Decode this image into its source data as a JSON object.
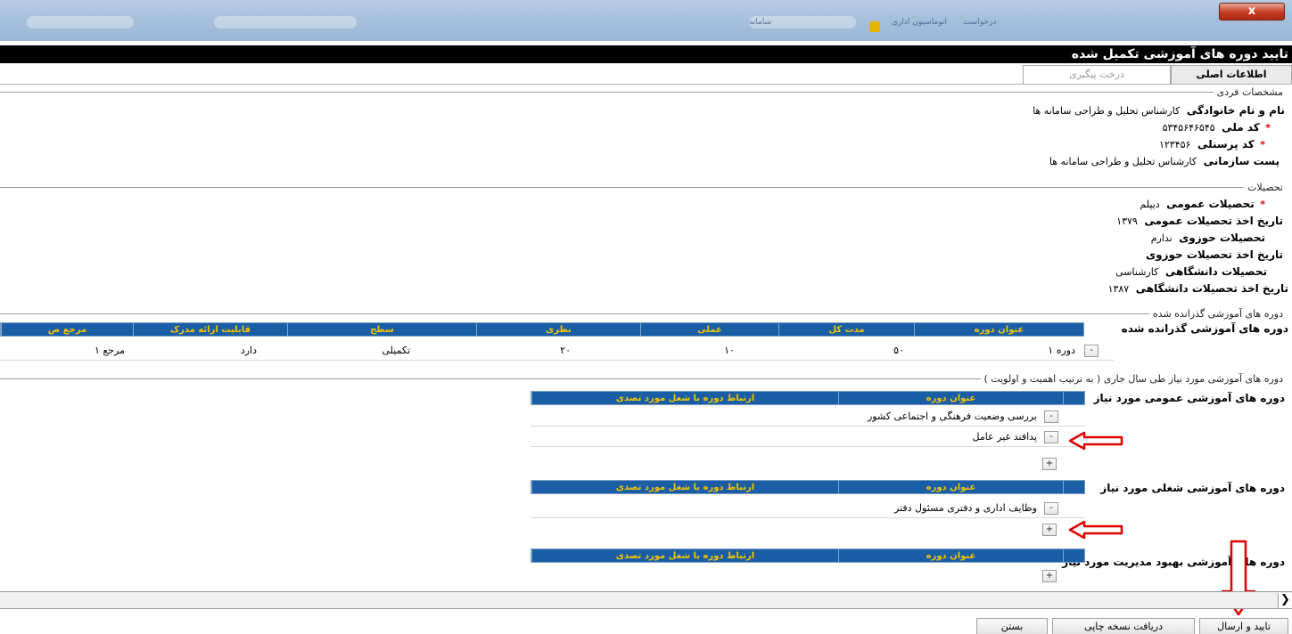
{
  "window": {
    "close_glyph": "x",
    "blurred_tabs": [
      "اتوماسیون اداری",
      "سامانه",
      "درخواست"
    ]
  },
  "page": {
    "title": "تایید دوره های آموزشی تکمیل شده"
  },
  "tabs": [
    {
      "label": "اطلاعات اصلی",
      "active": true
    },
    {
      "label": "درخت پیگیری",
      "active": false
    }
  ],
  "personal": {
    "legend": "مشخصات فردی",
    "fields": [
      {
        "label": "نام و نام خانوادگی",
        "value": "کارشناس تحلیل و طراحی سامانه ها",
        "required": false
      },
      {
        "label": "کد ملی",
        "value": "۵۳۴۵۶۴۶۵۴۵",
        "required": true
      },
      {
        "label": "کد پرسنلی",
        "value": "۱۲۳۴۵۶",
        "required": true
      },
      {
        "label": "پست سازمانی",
        "value": "کارشناس تحلیل و طراحی سامانه ها",
        "required": false
      }
    ]
  },
  "education": {
    "legend": "تحصیلات",
    "fields": [
      {
        "label": "تحصیلات عمومی",
        "value": "دیپلم",
        "required": true
      },
      {
        "label": "تاریخ اخذ تحصیلات عمومی",
        "value": "۱۳۷۹",
        "required": false
      },
      {
        "label": "تحصیلات حوزوی",
        "value": "ندارم",
        "required": false
      },
      {
        "label": "تاریخ اخذ تحصیلات حوزوی",
        "value": "",
        "required": false
      },
      {
        "label": "تحصیلات دانشگاهی",
        "value": "کارشناسی",
        "required": false
      },
      {
        "label": "تاریخ اخذ تحصیلات دانشگاهی",
        "value": "۱۳۸۷",
        "required": false
      }
    ]
  },
  "completed": {
    "legend": "دوره های آموزشی گذرانده شده",
    "section_title": "دوره های آموزشی گذرانده شده",
    "columns": [
      "عنوان دوره",
      "مدت کل",
      "عملی",
      "نظری",
      "سطح",
      "قابلیت ارائه مدرک",
      "مرجع ص"
    ],
    "rows": [
      {
        "title": "دوره ۱",
        "total": "۵۰",
        "practical": "۱۰",
        "theory": "۲۰",
        "level": "تکمیلی",
        "certificate": "دارد",
        "reference": "مرجع ۱",
        "remove": "-"
      }
    ]
  },
  "needed": {
    "legend": "دوره های آموزشی مورد نیاز طی سال جاری ( به ترتیب اهمیت و اولویت )",
    "columns": [
      "عنوان دوره",
      "ارتباط دوره با شغل مورد تصدی"
    ],
    "general": {
      "title": "دوره های آموزشی عمومی مورد نیاز",
      "rows": [
        {
          "title": "بررسی وضعیت فرهنگی و اجتماعی کشور",
          "remove": "-"
        },
        {
          "title": "پدافند غیر عامل",
          "remove": "-"
        }
      ],
      "add": "+"
    },
    "job": {
      "title": "دوره های آموزشی شغلی مورد نیاز",
      "rows": [
        {
          "title": "وظایف اداری و دفتری مسئول دفتر",
          "remove": "-"
        }
      ],
      "add": "+"
    },
    "management": {
      "title": "دوره های آموزشی بهبود مدیریت مورد نیاز",
      "rows": [],
      "add": "+"
    }
  },
  "scroll": {
    "arrow": "❯"
  },
  "buttons": {
    "confirm": "تایید و ارسال",
    "print": "دریافت نسخه چاپی",
    "close": "بستن"
  },
  "colors": {
    "header_bg": "#1a5ea6",
    "header_text": "#f4c400",
    "required_star": "#e00000",
    "annotation_arrow": "#e00000"
  }
}
